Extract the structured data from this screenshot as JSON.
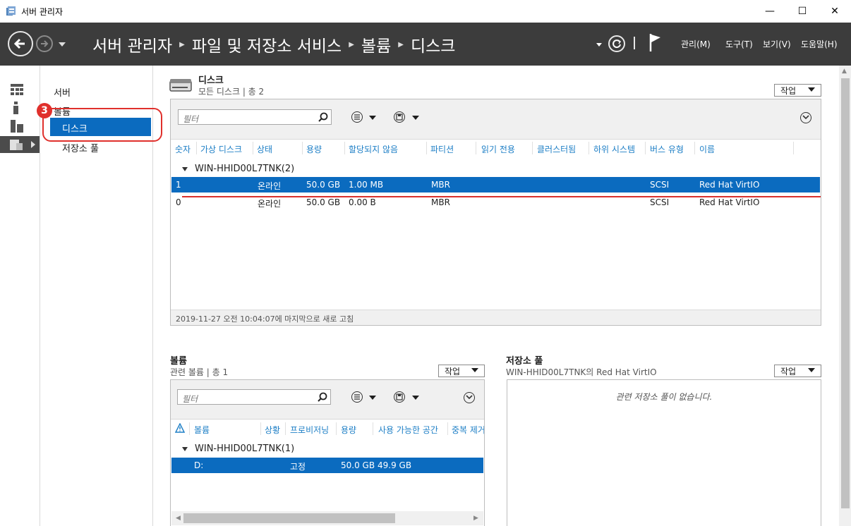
{
  "window": {
    "title": "서버 관리자",
    "minimize_glyph": "—",
    "maximize_glyph": "☐",
    "close_glyph": "✕"
  },
  "header": {
    "breadcrumbs": [
      "서버 관리자",
      "파일 및 저장소 서비스",
      "볼륨",
      "디스크"
    ],
    "menu": [
      "관리(M)",
      "도구(T)",
      "보기(V)",
      "도움말(H)"
    ]
  },
  "nav": {
    "items": [
      "서버",
      "볼륨",
      "디스크",
      "저장소 풀"
    ],
    "callout_number": "3"
  },
  "disks": {
    "title": "디스크",
    "subtitle": "모든 디스크 | 총 2",
    "task_label": "작업",
    "filter_placeholder": "필터",
    "columns": [
      "숫자",
      "가상 디스크",
      "상태",
      "용량",
      "할당되지 않음",
      "파티션",
      "읽기 전용",
      "클러스터됨",
      "하위 시스템",
      "버스 유형",
      "이름"
    ],
    "group": "WIN-HHID00L7TNK(2)",
    "rows": [
      {
        "number": "1",
        "status": "온라인",
        "capacity": "50.0 GB",
        "unallocated": "1.00 MB",
        "partition": "MBR",
        "bus": "SCSI",
        "name": "Red Hat VirtIO"
      },
      {
        "number": "0",
        "status": "온라인",
        "capacity": "50.0 GB",
        "unallocated": "0.00 B",
        "partition": "MBR",
        "bus": "SCSI",
        "name": "Red Hat VirtIO"
      }
    ],
    "refresh_status": "2019-11-27 오전 10:04:07에 마지막으로 새로 고침"
  },
  "volumes": {
    "title": "볼륨",
    "subtitle": "관련 볼륨 | 총 1",
    "task_label": "작업",
    "filter_placeholder": "필터",
    "columns": [
      "볼륨",
      "상황",
      "프로비저닝",
      "용량",
      "사용 가능한 공간",
      "중복 제거"
    ],
    "group": "WIN-HHID00L7TNK(1)",
    "rows": [
      {
        "volume": "D:",
        "provisioning": "고정",
        "capacity": "50.0 GB",
        "free": "49.9 GB"
      }
    ]
  },
  "pools": {
    "title": "저장소 풀",
    "subtitle": "WIN-HHID00L7TNK의 Red Hat VirtIO",
    "task_label": "작업",
    "empty_message": "관련 저장소 풀이 없습니다."
  },
  "colors": {
    "accent": "#0b6bbf",
    "header_bg": "#3c3c3c",
    "callout": "#e0302c",
    "column_header": "#1e7fc6"
  }
}
